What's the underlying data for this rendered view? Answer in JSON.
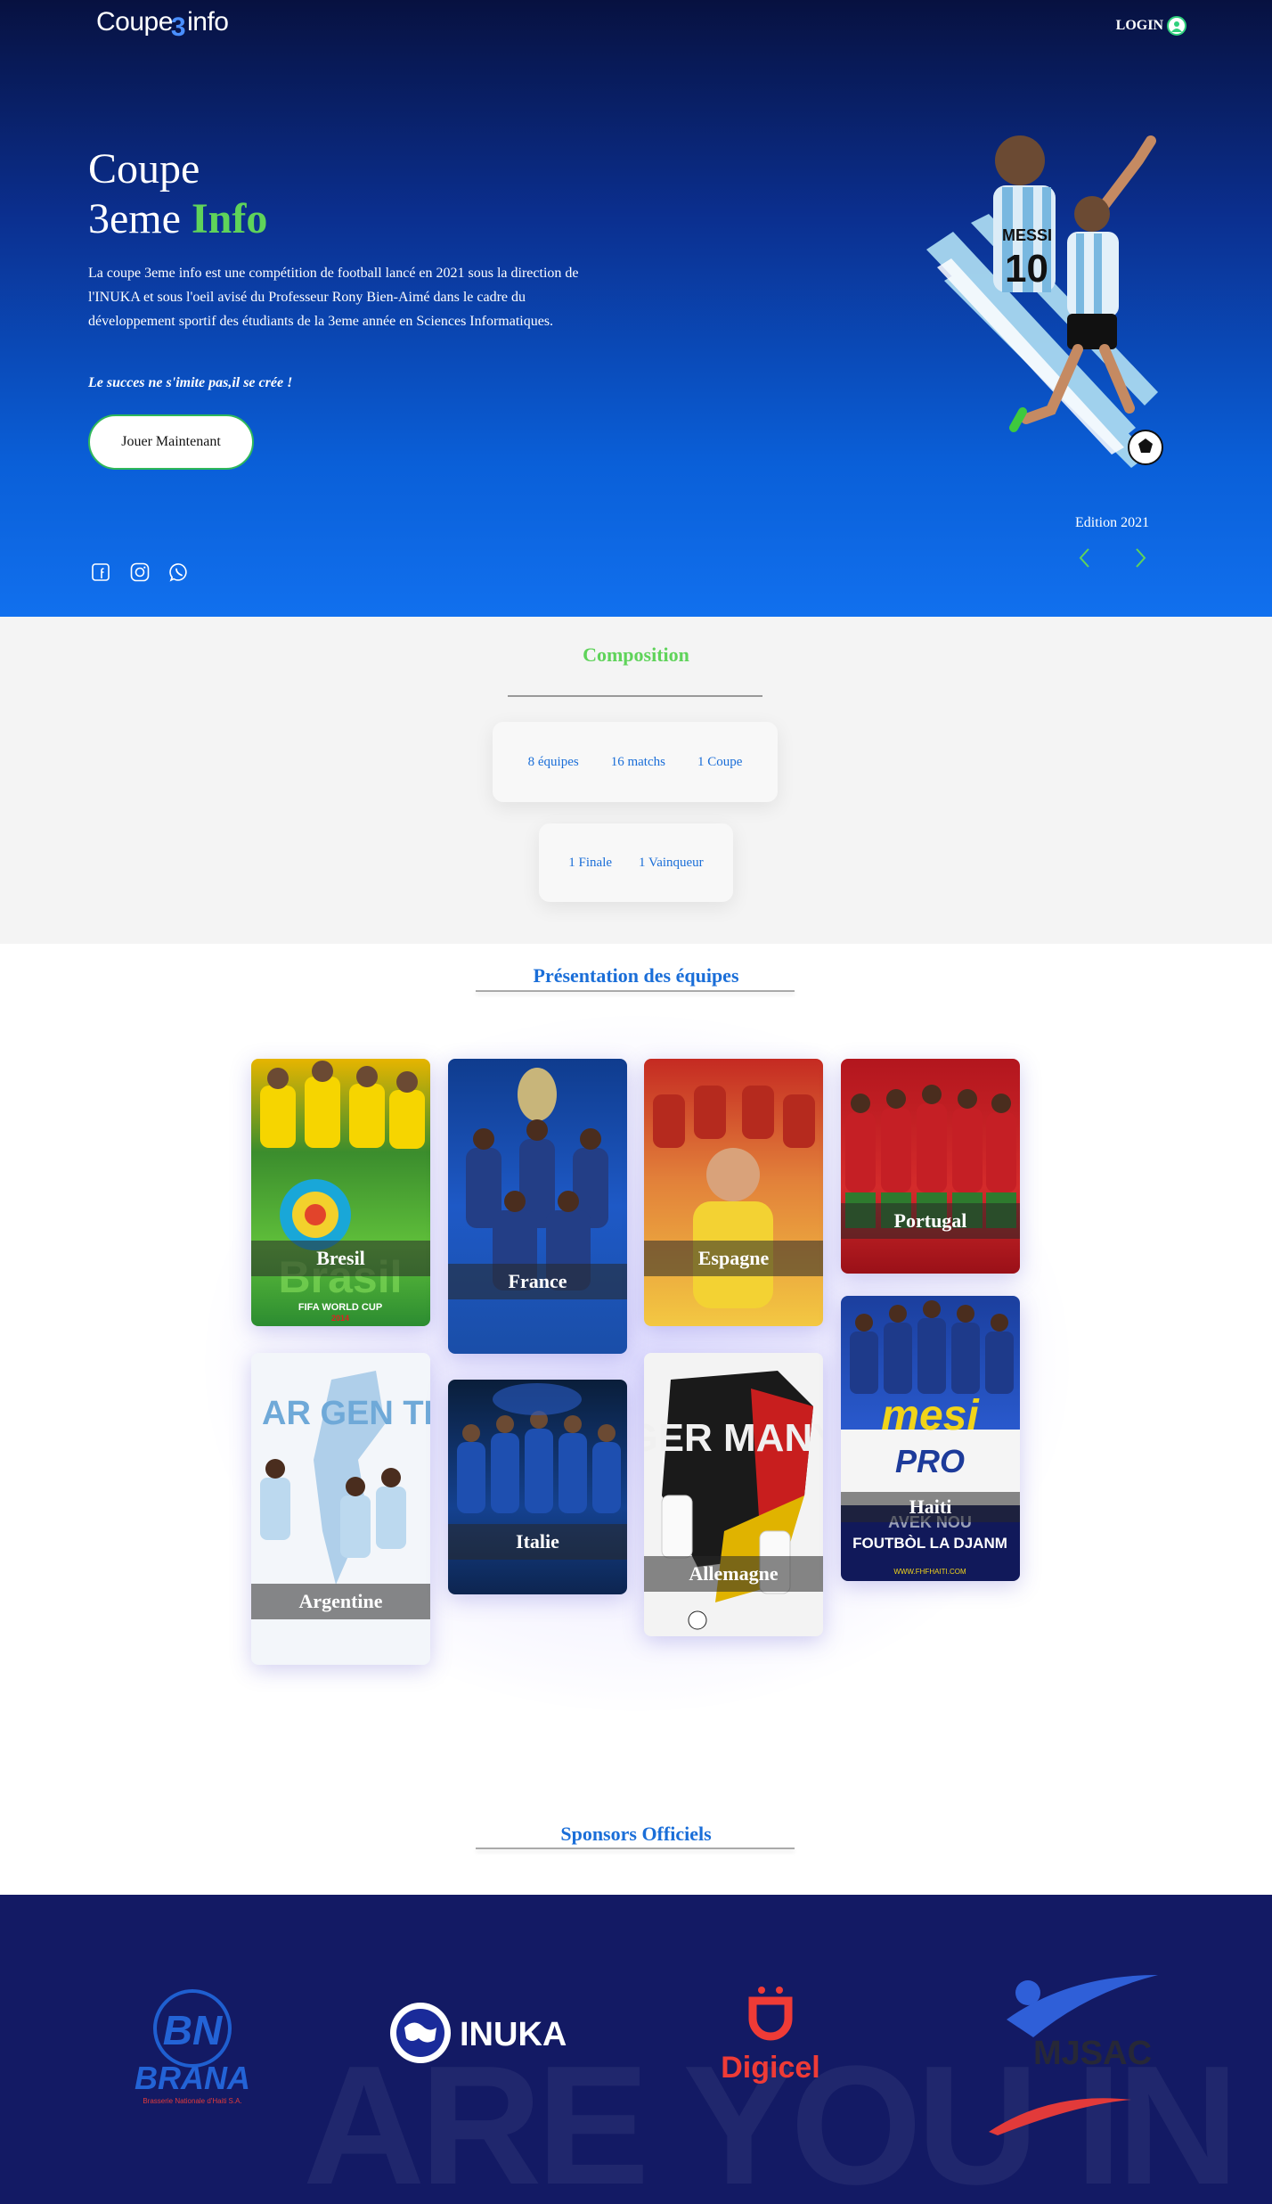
{
  "header": {
    "logo_main": "Coupe",
    "logo_number": "3",
    "logo_suffix": "info",
    "login_label": "LOGIN"
  },
  "hero": {
    "title_line1": "Coupe",
    "title_line2": "3eme",
    "title_accent": "Info",
    "description": "La coupe 3eme info est une compétition de football lancé en 2021 sous la direction de l'INUKA et sous l'oeil avisé du Professeur Rony Bien-Aimé dans le cadre du développement sportif des étudiants de la 3eme année en Sciences Informatiques.",
    "quote": "Le succes ne s'imite pas,il se crée !",
    "cta_label": "Jouer Maintenant",
    "edition_label": "Edition 2021",
    "player_jersey_name": "MESSI",
    "player_jersey_number": "10",
    "social_icons": [
      "facebook-icon",
      "instagram-icon",
      "whatsapp-icon"
    ]
  },
  "composition": {
    "title": "Composition",
    "stats_row1": [
      "8 équipes",
      "16 matchs",
      "1 Coupe"
    ],
    "stats_row2": [
      "1 Finale",
      "1 Vainqueur"
    ]
  },
  "teams": {
    "title": "Présentation des équipes",
    "items": [
      {
        "name": "Bresil",
        "poster_text": "FIFA WORLD CUP",
        "poster_year": "2014"
      },
      {
        "name": "France"
      },
      {
        "name": "Espagne"
      },
      {
        "name": "Portugal"
      },
      {
        "name": "Argentine",
        "poster_text": "AR GEN TINA"
      },
      {
        "name": "Italie"
      },
      {
        "name": "Allemagne",
        "poster_text": "GER MANY"
      },
      {
        "name": "Haiti",
        "poster_text": "mesi",
        "poster_sub": "PRO",
        "poster_tag": "AVEK NOU",
        "poster_slogan": "FOUTBÒL LA DJANM",
        "poster_url": "WWW.FHFHAITI.COM"
      }
    ]
  },
  "sponsors": {
    "title": "Sponsors Officiels",
    "background_text": "ARE YOU IN",
    "items": [
      {
        "name": "BRANA",
        "initials": "BN",
        "tagline": "Brasserie Nationale d'Haiti S.A."
      },
      {
        "name": "INUKA"
      },
      {
        "name": "Digicel"
      },
      {
        "name": "MJSAC"
      }
    ]
  },
  "colors": {
    "accent_green": "#5fd35a",
    "link_blue": "#1a6ed8",
    "footer_navy": "#131a64"
  }
}
